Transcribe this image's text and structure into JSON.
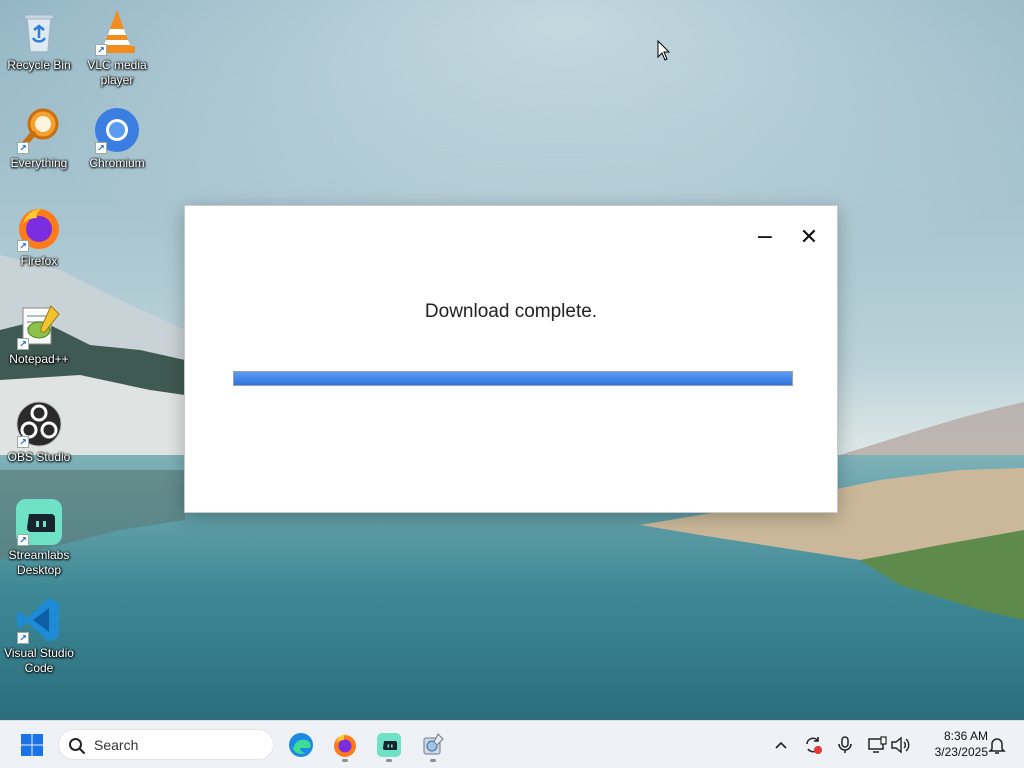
{
  "desktop": {
    "icons": [
      {
        "label": "Recycle Bin",
        "icon": "recycle-bin-icon"
      },
      {
        "label": "VLC media player",
        "icon": "vlc-icon"
      },
      {
        "label": "Everything",
        "icon": "everything-icon"
      },
      {
        "label": "Chromium",
        "icon": "chromium-icon"
      },
      {
        "label": "Firefox",
        "icon": "firefox-icon"
      },
      {
        "label": "Notepad++",
        "icon": "notepadpp-icon"
      },
      {
        "label": "OBS Studio",
        "icon": "obs-icon"
      },
      {
        "label": "Streamlabs Desktop",
        "icon": "streamlabs-icon"
      },
      {
        "label": "Visual Studio Code",
        "icon": "vscode-icon"
      }
    ]
  },
  "dialog": {
    "minimize_symbol": "−",
    "close_symbol": "✕",
    "message": "Download complete.",
    "progress_percent": 100,
    "accent_color": "#3a7ee6"
  },
  "taskbar": {
    "search_placeholder": "Search",
    "apps": [
      "start-icon",
      "edge-icon",
      "firefox-icon",
      "streamlabs-icon",
      "installer-icon"
    ],
    "tray": [
      "chevron-up-icon",
      "sync-icon",
      "microphone-icon",
      "network-icon",
      "volume-icon",
      "notification-bell-icon"
    ],
    "time": "8:36 AM",
    "date": "3/23/2025"
  }
}
